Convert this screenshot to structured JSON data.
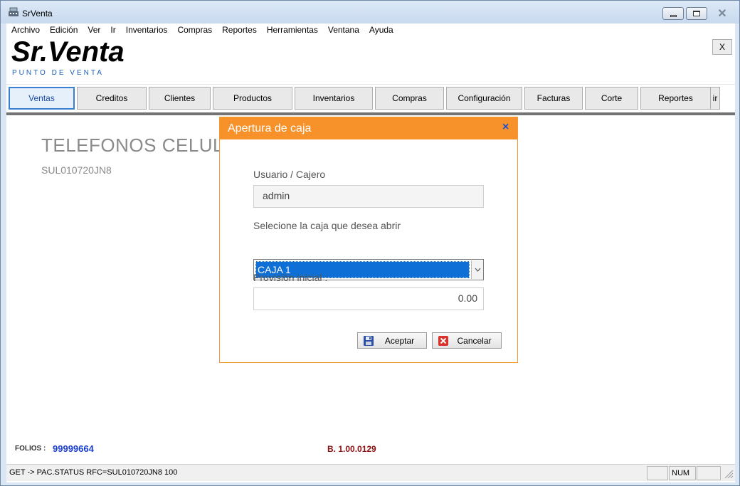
{
  "window": {
    "title": "SrVenta"
  },
  "menu": [
    "Archivo",
    "Edición",
    "Ver",
    "Ir",
    "Inventarios",
    "Compras",
    "Reportes",
    "Herramientas",
    "Ventana",
    "Ayuda"
  ],
  "header": {
    "brand": "Sr.Venta",
    "subtitle": "PUNTO DE VENTA",
    "close_label": "X"
  },
  "toolbar": {
    "tabs": [
      "Ventas",
      "Creditos",
      "Clientes",
      "Productos",
      "Inventarios",
      "Compras",
      "Configuración",
      "Facturas",
      "Corte",
      "Reportes",
      "ir"
    ],
    "active": "Ventas"
  },
  "main": {
    "company_name": "TELEFONOS CELULAR",
    "rfc": "SUL010720JN8",
    "folios_label": "FOLIOS :",
    "folios_value": "99999664",
    "version": "B. 1.00.0129"
  },
  "statusbar": {
    "text": "GET -> PAC.STATUS RFC=SUL010720JN8 100",
    "num": "NUM"
  },
  "dialog": {
    "title": "Apertura de caja",
    "close_icon": "×",
    "user_label": "Usuario / Cajero",
    "user_value": "admin",
    "caja_label": "Selecione la caja que desea abrir",
    "caja_value": "CAJA 1",
    "provision_label": "Provisión inicial :",
    "provision_value": "0.00",
    "accept_label": "Aceptar",
    "cancel_label": "Cancelar"
  },
  "colors": {
    "dialog_header": "#f7922a",
    "select_highlight": "#0e6fd6",
    "folios": "#1a3fcf",
    "version": "#8b1010"
  }
}
